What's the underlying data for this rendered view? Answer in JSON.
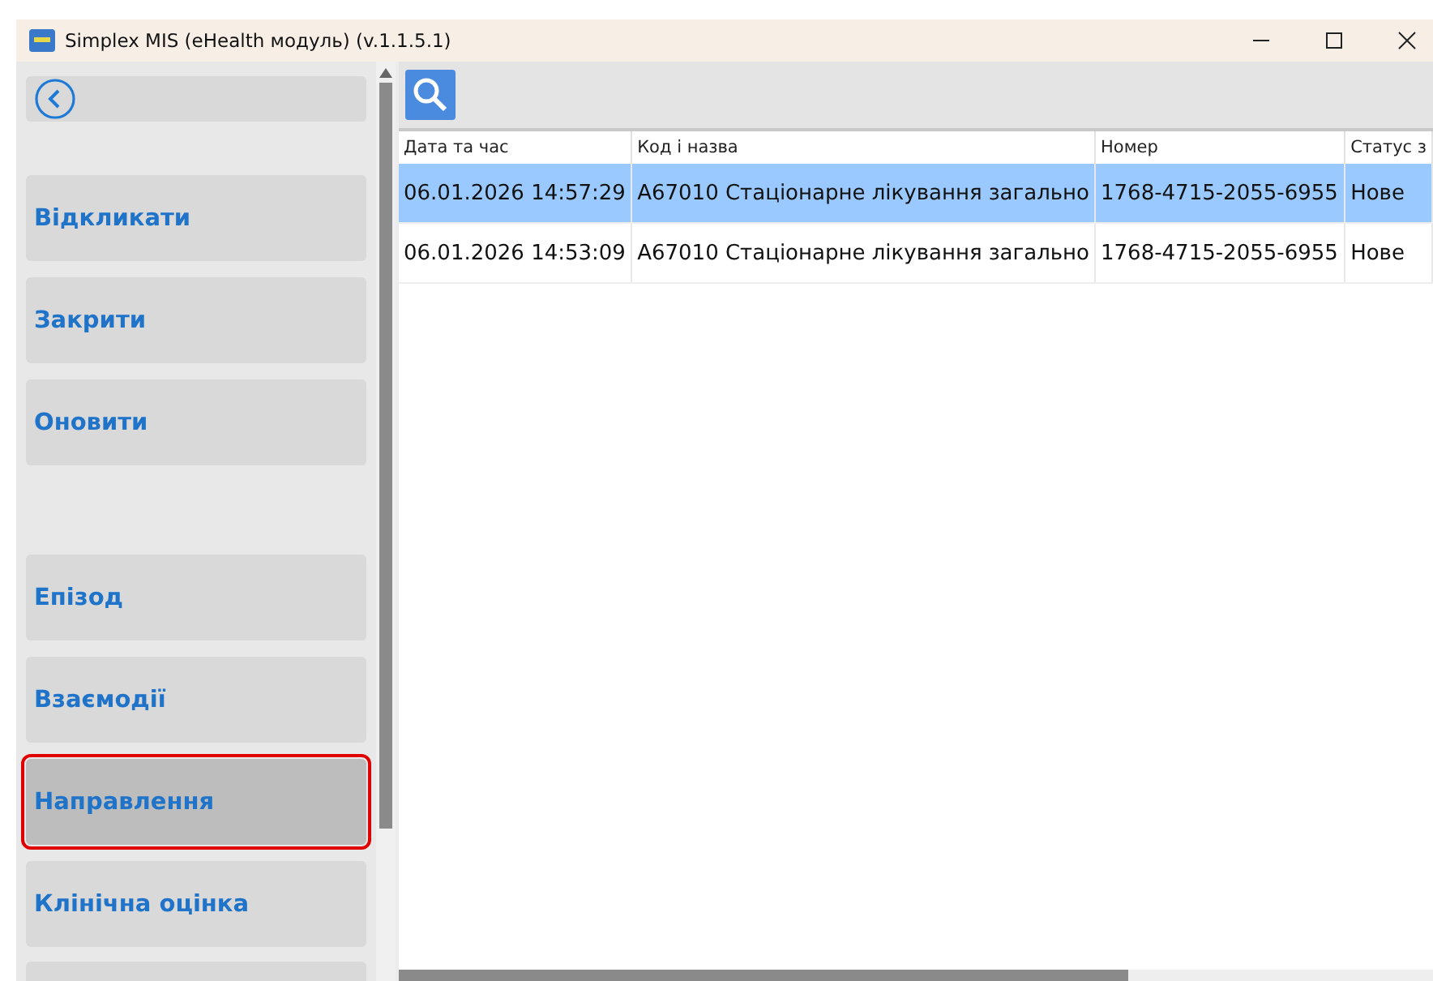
{
  "window": {
    "title": "Simplex MIS (eHealth модуль) (v.1.1.5.1)"
  },
  "sidebar": {
    "groups": [
      [
        {
          "label": "Відкликати",
          "selected": false
        },
        {
          "label": "Закрити",
          "selected": false
        },
        {
          "label": "Оновити",
          "selected": false
        }
      ],
      [
        {
          "label": "Епізод",
          "selected": false
        },
        {
          "label": "Взаємодії",
          "selected": false
        },
        {
          "label": "Направлення",
          "selected": true
        },
        {
          "label": "Клінічна оцінка",
          "selected": false
        }
      ]
    ]
  },
  "table": {
    "columns": [
      "Дата та час",
      "Код і назва",
      "Номер",
      "Статус з"
    ],
    "rows": [
      {
        "cells": [
          "06.01.2026 14:57:29",
          "А67010 Стаціонарне лікування загально",
          "1768-4715-2055-6955",
          "Нове"
        ],
        "selected": true
      },
      {
        "cells": [
          "06.01.2026 14:53:09",
          "А67010 Стаціонарне лікування загально",
          "1768-4715-2055-6955",
          "Нове"
        ],
        "selected": false
      }
    ]
  }
}
